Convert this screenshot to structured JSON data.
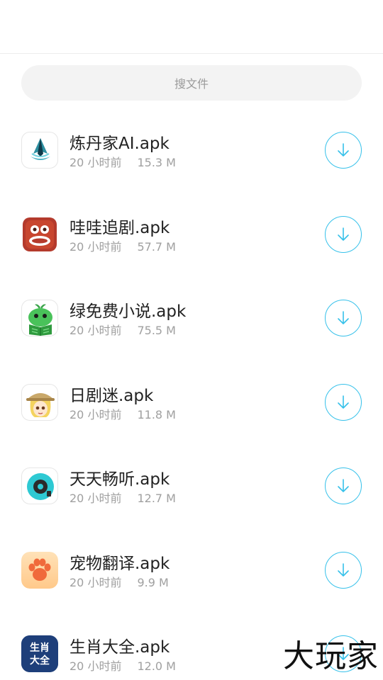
{
  "search": {
    "placeholder": "搜文件"
  },
  "files": [
    {
      "name": "炼丹家AI.apk",
      "time": "20 小时前",
      "size": "15.3 M",
      "icon": "liandanjia-app-icon"
    },
    {
      "name": "哇哇追剧.apk",
      "time": "20 小时前",
      "size": "57.7 M",
      "icon": "wawazhuiju-app-icon"
    },
    {
      "name": "绿免费小说.apk",
      "time": "20 小时前",
      "size": "75.5 M",
      "icon": "green-novel-app-icon"
    },
    {
      "name": "日剧迷.apk",
      "time": "20 小时前",
      "size": "11.8 M",
      "icon": "rijumi-app-icon"
    },
    {
      "name": "天天畅听.apk",
      "time": "20 小时前",
      "size": "12.7 M",
      "icon": "tiantian-changting-app-icon"
    },
    {
      "name": "宠物翻译.apk",
      "time": "20 小时前",
      "size": "9.9 M",
      "icon": "pet-translate-app-icon"
    },
    {
      "name": "生肖大全.apk",
      "time": "20 小时前",
      "size": "12.0 M",
      "icon": "shengxiao-app-icon"
    }
  ],
  "icon_texts": {
    "shengxiao_line1": "生肖",
    "shengxiao_line2": "大全"
  },
  "watermark": "大玩家",
  "colors": {
    "accent": "#36c1ea",
    "text": "#222222",
    "muted": "#a0a0a0"
  }
}
